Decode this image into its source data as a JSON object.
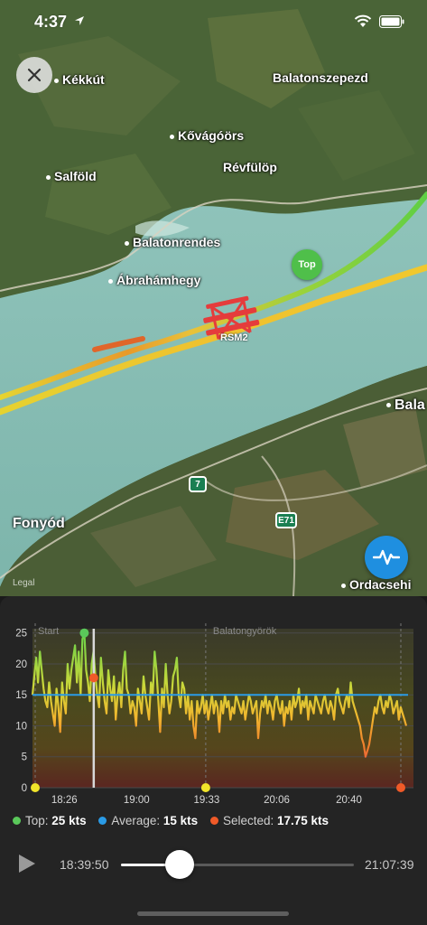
{
  "status_bar": {
    "time": "4:37"
  },
  "map": {
    "places": [
      {
        "key": "kekkut",
        "label": "Kékkút"
      },
      {
        "key": "balatonszepezd",
        "label": "Balatonszepezd"
      },
      {
        "key": "kovagoors",
        "label": "Kővágóörs"
      },
      {
        "key": "salfold",
        "label": "Salföld"
      },
      {
        "key": "revfulop",
        "label": "Révfülöp"
      },
      {
        "key": "balatonrendes",
        "label": "Balatonrendes"
      },
      {
        "key": "abrahamhegy",
        "label": "Ábrahámhegy"
      },
      {
        "key": "bala",
        "label": "Bala"
      },
      {
        "key": "fonyod",
        "label": "Fonyód"
      },
      {
        "key": "ordacsehi",
        "label": "Ordacsehi"
      }
    ],
    "top_badge": "Top",
    "boat_label": "RSM2",
    "road_7": "7",
    "road_e71": "E71",
    "legal": "Legal",
    "icons": {
      "close": "close-icon",
      "activity": "activity-pulse-icon",
      "location": "location-arrow-icon",
      "wifi": "wifi-icon",
      "battery": "battery-icon"
    }
  },
  "chart_data": {
    "type": "line",
    "y_ticks": [
      "25",
      "20",
      "15",
      "10",
      "5",
      "0"
    ],
    "ylim": [
      0,
      27
    ],
    "x_ticks": [
      "18:26",
      "19:00",
      "19:33",
      "20:06",
      "20:40"
    ],
    "x_range": [
      "18:11",
      "21:07"
    ],
    "annotations": [
      "Start",
      "Balatongyörök"
    ],
    "average": 15,
    "top": 25,
    "selected": 17.75,
    "selected_time": "18:39:50",
    "series": [
      {
        "unit": "kts",
        "time_range": [
          "18:11",
          "21:07"
        ],
        "values": [
          15,
          18,
          21,
          17,
          22,
          19,
          16,
          14,
          13,
          17,
          14,
          12,
          10,
          16,
          13,
          9,
          17,
          14,
          12,
          20,
          16,
          19,
          21,
          23,
          17,
          22,
          15,
          24,
          25,
          19,
          17,
          14,
          20,
          22,
          18,
          15,
          13,
          21,
          17,
          14,
          12,
          19,
          16,
          14,
          18,
          11,
          15,
          17,
          13,
          19,
          22,
          16,
          15,
          12,
          14,
          13,
          10,
          16,
          14,
          12,
          18,
          15,
          13,
          11,
          17,
          15,
          22,
          19,
          14,
          9,
          16,
          13,
          20,
          15,
          12,
          14,
          18,
          19,
          21,
          15,
          13,
          17,
          16,
          12,
          15,
          11,
          14,
          10,
          8,
          14,
          12,
          13,
          15,
          12,
          14,
          11,
          13,
          15,
          12,
          14,
          13,
          9,
          14,
          12,
          15,
          13,
          14,
          11,
          13,
          12,
          15,
          14,
          13,
          12,
          14,
          11,
          13,
          15,
          14,
          12,
          13,
          14,
          8,
          12,
          14,
          13,
          15,
          12,
          14,
          13,
          11,
          14,
          15,
          13,
          12,
          14,
          10,
          13,
          12,
          14,
          11,
          15,
          13,
          14,
          16,
          12,
          14,
          13,
          15,
          11,
          14,
          13,
          12,
          15,
          14,
          13,
          12,
          14,
          15,
          13,
          12,
          14,
          13,
          11,
          15,
          16,
          14,
          13,
          12,
          14,
          15,
          13,
          17,
          14,
          13,
          12,
          11,
          10,
          8,
          7,
          5,
          6,
          7,
          9,
          11,
          13,
          12,
          14,
          15,
          13,
          12,
          14,
          13,
          15,
          14,
          12,
          13,
          14,
          11,
          13,
          12,
          11,
          10
        ]
      }
    ]
  },
  "legend": [
    {
      "key": "top",
      "label": "Top:",
      "value": "25 kts",
      "color": "#5ac85a"
    },
    {
      "key": "average",
      "label": "Average:",
      "value": "15 kts",
      "color": "#2a9be6"
    },
    {
      "key": "selected",
      "label": "Selected:",
      "value": "17.75 kts",
      "color": "#f05a28"
    }
  ],
  "player": {
    "start_time": "18:39:50",
    "end_time": "21:07:39",
    "progress": 0.25
  }
}
